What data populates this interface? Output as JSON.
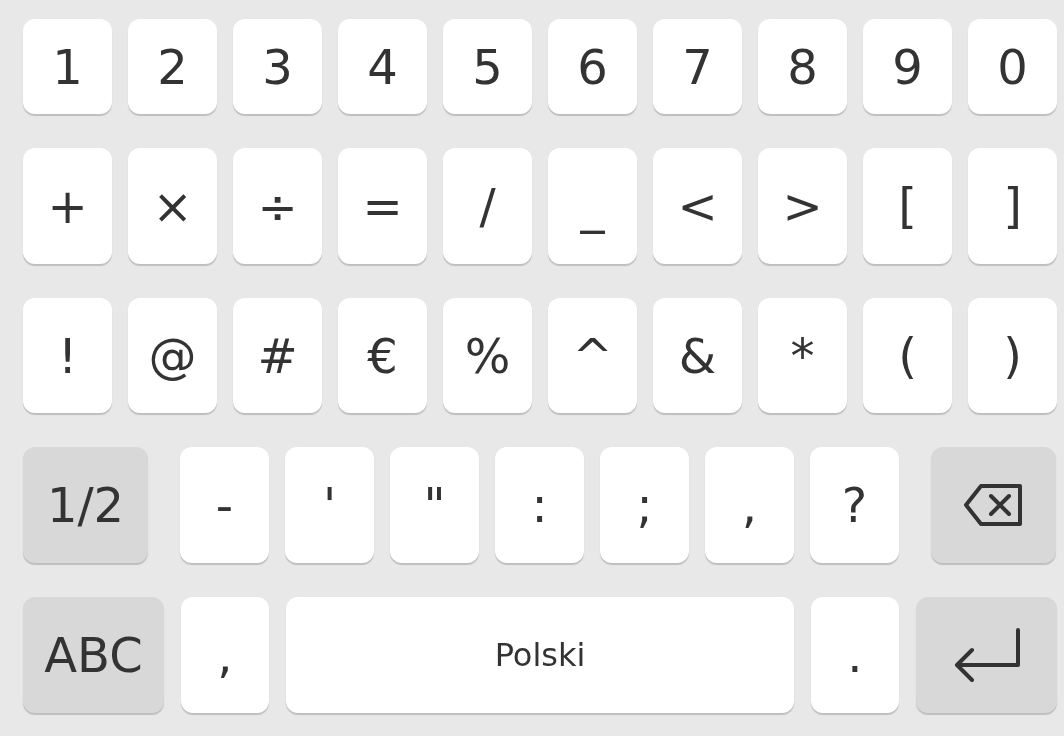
{
  "rows": [
    {
      "keys": [
        {
          "kind": "char",
          "label": "1"
        },
        {
          "kind": "char",
          "label": "2"
        },
        {
          "kind": "char",
          "label": "3"
        },
        {
          "kind": "char",
          "label": "4"
        },
        {
          "kind": "char",
          "label": "5"
        },
        {
          "kind": "char",
          "label": "6"
        },
        {
          "kind": "char",
          "label": "7"
        },
        {
          "kind": "char",
          "label": "8"
        },
        {
          "kind": "char",
          "label": "9"
        },
        {
          "kind": "char",
          "label": "0"
        }
      ]
    },
    {
      "keys": [
        {
          "kind": "char",
          "label": "+"
        },
        {
          "kind": "char",
          "label": "×"
        },
        {
          "kind": "char",
          "label": "÷"
        },
        {
          "kind": "char",
          "label": "="
        },
        {
          "kind": "char",
          "label": "/"
        },
        {
          "kind": "char",
          "label": "_"
        },
        {
          "kind": "char",
          "label": "<"
        },
        {
          "kind": "char",
          "label": ">"
        },
        {
          "kind": "char",
          "label": "["
        },
        {
          "kind": "char",
          "label": "]"
        }
      ]
    },
    {
      "keys": [
        {
          "kind": "char",
          "label": "!"
        },
        {
          "kind": "char",
          "label": "@"
        },
        {
          "kind": "char",
          "label": "#"
        },
        {
          "kind": "char",
          "label": "€"
        },
        {
          "kind": "char",
          "label": "%"
        },
        {
          "kind": "char",
          "label": "^"
        },
        {
          "kind": "char",
          "label": "&"
        },
        {
          "kind": "char",
          "label": "*"
        },
        {
          "kind": "char",
          "label": "("
        },
        {
          "kind": "char",
          "label": ")"
        }
      ]
    },
    {
      "keys": [
        {
          "kind": "mode",
          "label": "1/2"
        },
        {
          "kind": "char",
          "label": "-"
        },
        {
          "kind": "char",
          "label": "'"
        },
        {
          "kind": "char",
          "label": "\""
        },
        {
          "kind": "char",
          "label": ":"
        },
        {
          "kind": "char",
          "label": ";"
        },
        {
          "kind": "char",
          "label": ","
        },
        {
          "kind": "char",
          "label": "?"
        },
        {
          "kind": "backspace"
        }
      ]
    },
    {
      "keys": [
        {
          "kind": "mode",
          "label": "ABC"
        },
        {
          "kind": "char",
          "label": ","
        },
        {
          "kind": "space",
          "label": "Polski"
        },
        {
          "kind": "char",
          "label": "."
        },
        {
          "kind": "enter"
        }
      ]
    }
  ]
}
